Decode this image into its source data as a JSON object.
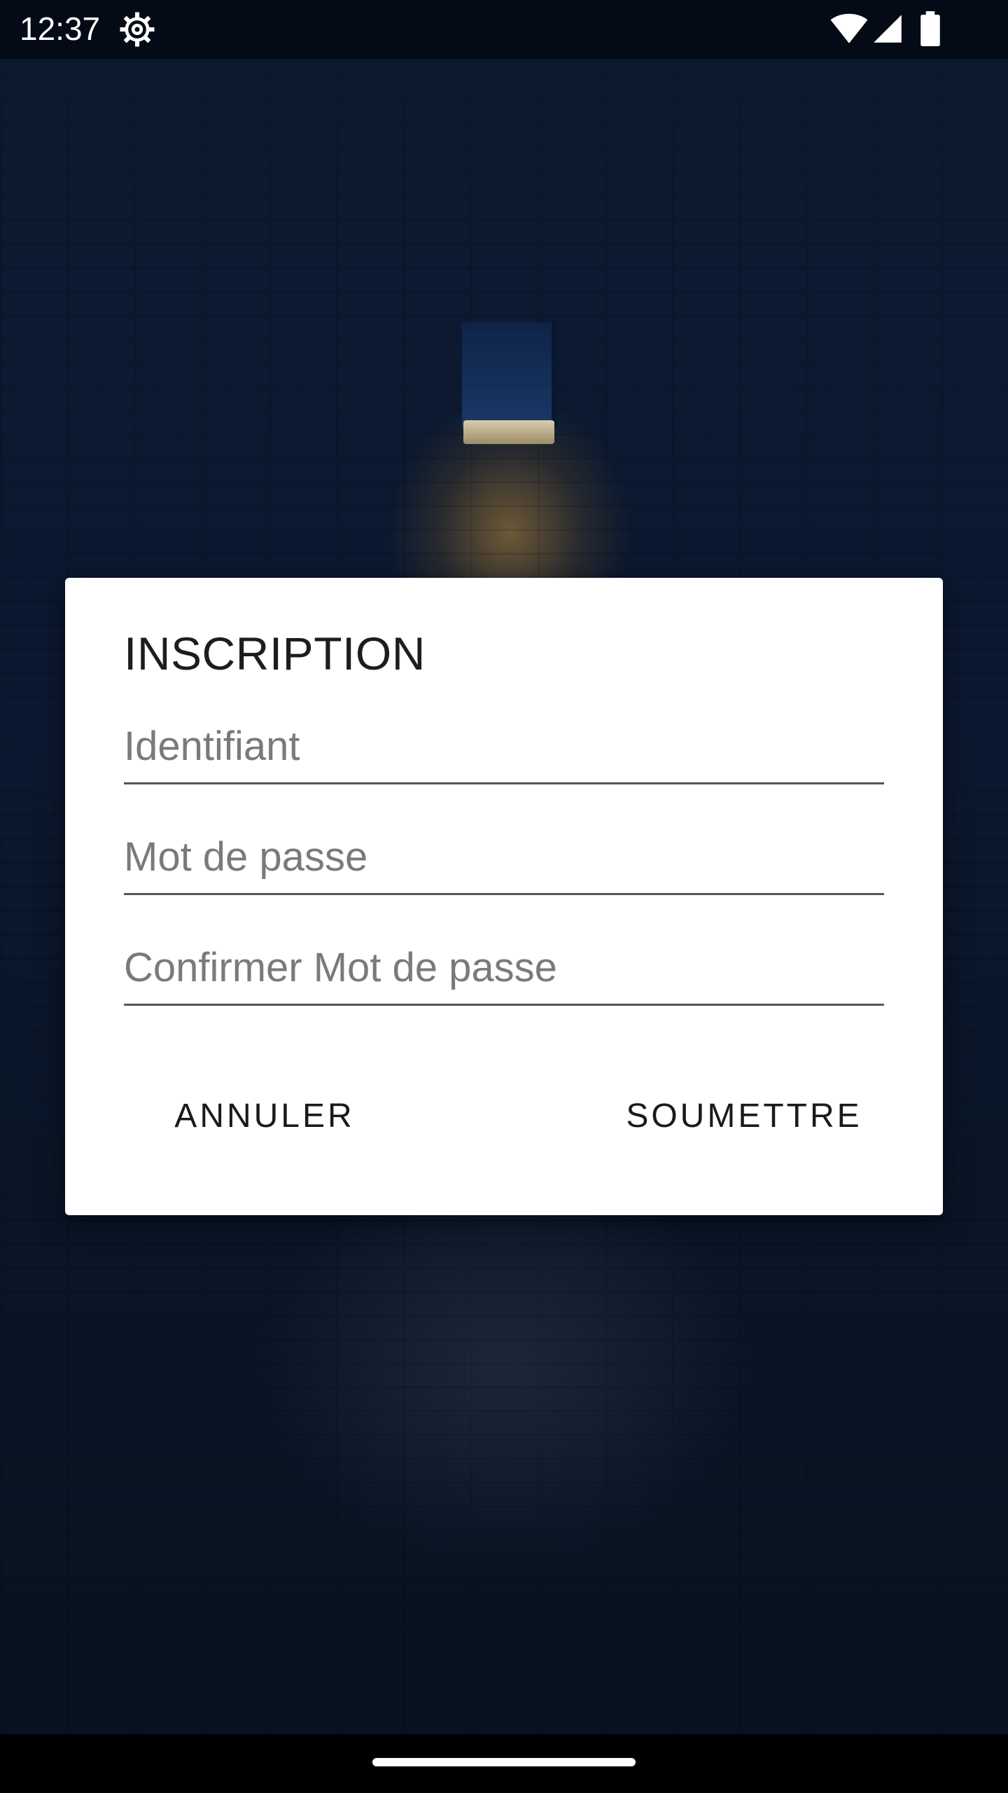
{
  "status_bar": {
    "time": "12:37",
    "icons": [
      "settings-gear-icon",
      "wifi-icon",
      "cell-signal-icon",
      "battery-icon"
    ]
  },
  "dialog": {
    "title": "INSCRIPTION",
    "fields": [
      {
        "placeholder": "Identifiant",
        "value": ""
      },
      {
        "placeholder": "Mot de passe",
        "value": ""
      },
      {
        "placeholder": "Confirmer Mot de passe",
        "value": ""
      }
    ],
    "cancel_label": "ANNULER",
    "submit_label": "SOUMETTRE"
  },
  "colors": {
    "background": "#0b1830",
    "dialog": "#ffffff",
    "text": "#1d1d1d",
    "placeholder": "#7a7a7a"
  }
}
